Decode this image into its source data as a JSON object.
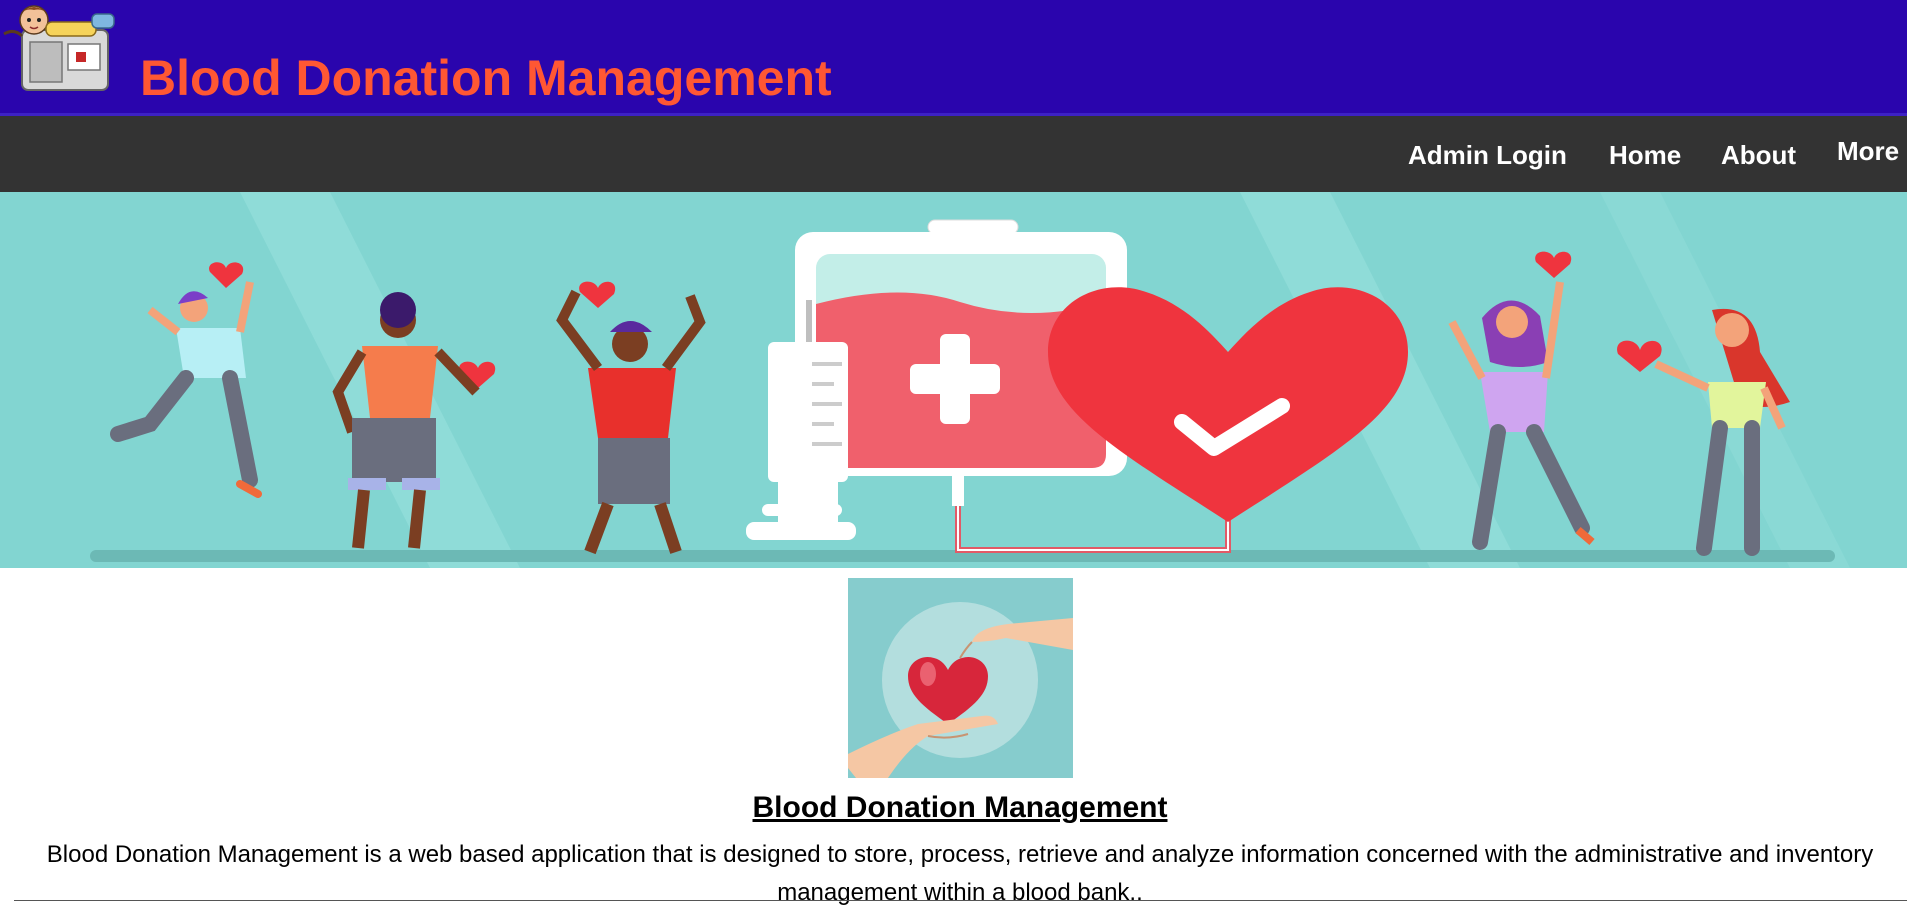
{
  "header": {
    "title": "Blood Donation Management",
    "background_color": "#2a05ad",
    "title_color": "#ff5733",
    "logo_icon": "blood-donation-logo-icon"
  },
  "nav": {
    "background_color": "#333333",
    "items": [
      {
        "label": "Admin Login"
      },
      {
        "label": "Home"
      },
      {
        "label": "About"
      },
      {
        "label": "More"
      }
    ]
  },
  "hero": {
    "illustration": "blood-donation-banner",
    "background_color": "#82d5d1"
  },
  "content": {
    "thumbnail_icon": "heart-in-hands-icon",
    "heading": "Blood Donation Management",
    "description": "Blood Donation Management is a web based application that is designed to store, process, retrieve and analyze information concerned with the administrative and inventory management within a blood bank.."
  }
}
